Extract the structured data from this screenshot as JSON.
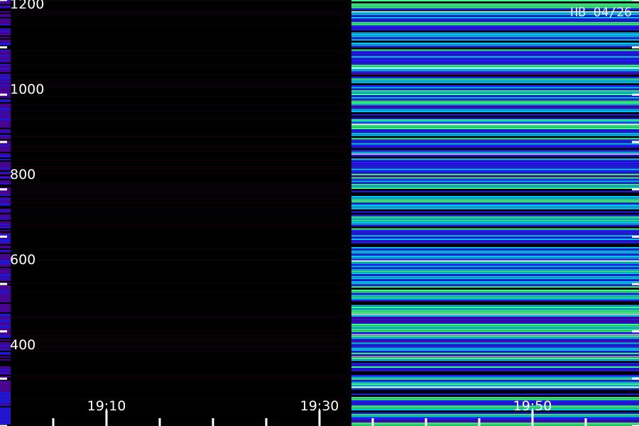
{
  "chart_data": {
    "type": "heatmap",
    "title": "",
    "xlabel": "",
    "ylabel": "",
    "station_label": "HB 04/26",
    "y_axis": {
      "range": [
        300,
        1200
      ],
      "labeled_ticks": [
        "400",
        "600",
        "800",
        "1000",
        "1200"
      ],
      "tick_values": [
        400,
        600,
        800,
        1000,
        1200
      ],
      "minor_ticks": [
        300,
        500,
        700,
        900,
        1100
      ]
    },
    "x_axis": {
      "range": [
        "19:00",
        "20:00"
      ],
      "labeled_ticks": [
        "19:10",
        "19:30",
        "19:50"
      ],
      "tick_times": [
        "19:10",
        "19:30",
        "19:50"
      ],
      "minor_ticks": [
        "19:05",
        "19:15",
        "19:20",
        "19:25",
        "19:35",
        "19:40",
        "19:45",
        "19:55"
      ]
    },
    "segments": [
      {
        "name": "",
        "time_range": [
          "19:00",
          "19:01"
        ],
        "intensity": "medium"
      },
      {
        "name": "",
        "time_range": [
          "19:01",
          "19:33"
        ],
        "intensity": "none"
      },
      {
        "name": "",
        "time_range": [
          "19:33",
          "20:00"
        ],
        "intensity": "high"
      }
    ],
    "colormap": [
      "#000000",
      "#5a00b4",
      "#2a1aff",
      "#00c8ff",
      "#3cff8c",
      "#ff3c3c",
      "#ffffff"
    ]
  }
}
